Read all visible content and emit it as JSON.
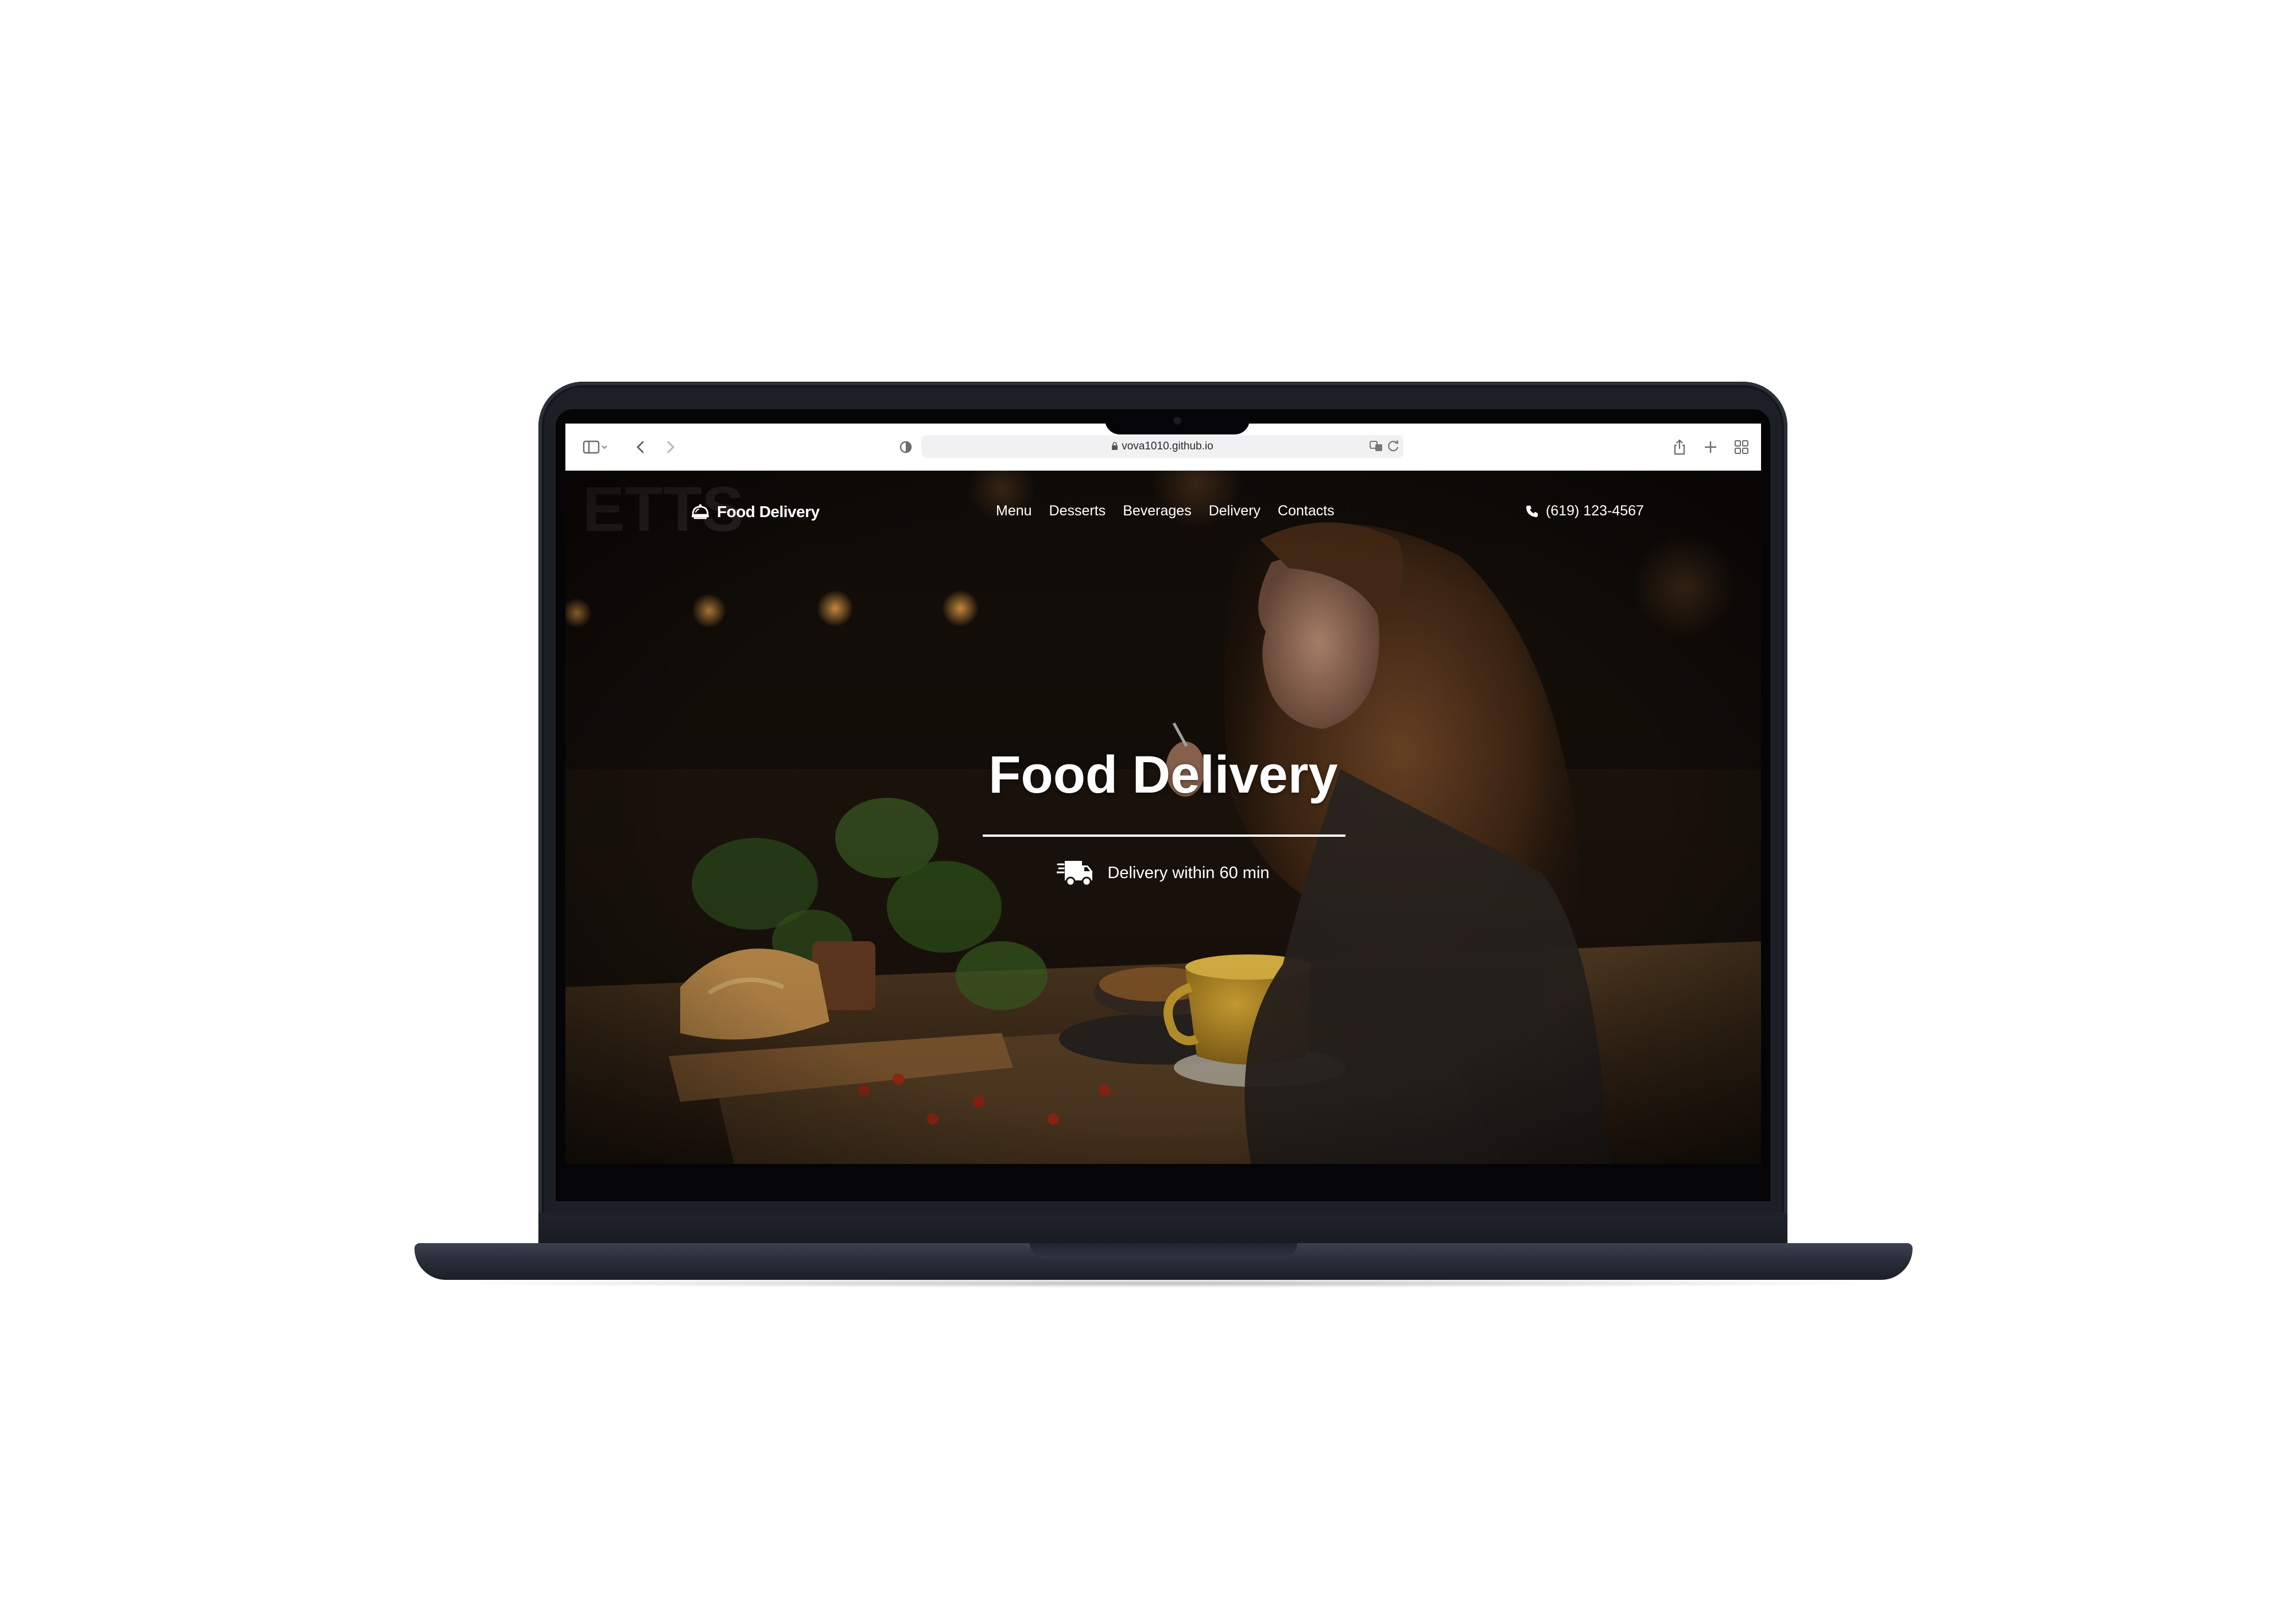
{
  "browser": {
    "url": "vova1010.github.io"
  },
  "site": {
    "brand": "Food Delivery",
    "nav_items": [
      "Menu",
      "Desserts",
      "Beverages",
      "Delivery",
      "Contacts"
    ],
    "phone": "(619) 123-4567",
    "hero_title": "Food Delivery",
    "hero_subtitle": "Delivery within 60 min"
  },
  "icons": {
    "logo": "food-cloche-icon",
    "phone": "phone-icon",
    "delivery": "delivery-truck-icon"
  },
  "colors": {
    "text": "#ffffff",
    "laptop_body": "#1c1f26",
    "page_bg": "#1a130d"
  }
}
